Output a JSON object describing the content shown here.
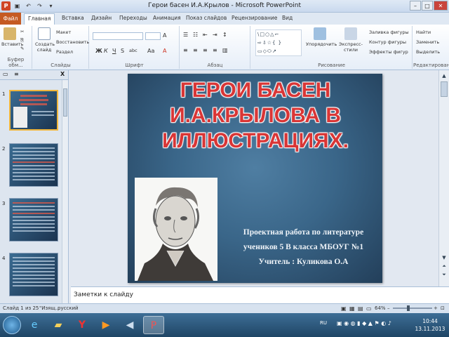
{
  "window": {
    "title": "Герои басен И.А.Крылов - Microsoft PowerPoint",
    "minimize": "–",
    "maximize": "□",
    "close": "✕"
  },
  "tabs": [
    "Файл",
    "Главная",
    "Вставка",
    "Дизайн",
    "Переходы",
    "Анимация",
    "Показ слайдов",
    "Рецензирование",
    "Вид"
  ],
  "ribbon": {
    "clipboard": {
      "paste": "Вставить",
      "group": "Буфер обм..."
    },
    "slides": {
      "create": "Создать слайд",
      "layout": "Макет",
      "reset": "Восстановить",
      "section": "Раздел",
      "group": "Слайды"
    },
    "font": {
      "group": "Шрифт",
      "bold": "Ж",
      "italic": "К",
      "underline": "Ч",
      "strike": "S",
      "shadow": "abc",
      "aa": "Aa",
      "size_up": "A",
      "color": "A"
    },
    "paragraph": {
      "group": "Абзац"
    },
    "drawing": {
      "arrange": "Упорядочить",
      "quick_styles": "Экспресс-стили",
      "fill": "Заливка фигуры",
      "outline": "Контур фигуры",
      "effects": "Эффекты фигур",
      "group": "Рисование"
    },
    "editing": {
      "find": "Найти",
      "replace": "Заменить",
      "select": "Выделить",
      "group": "Редактирование"
    }
  },
  "panel": {
    "tab_slides": "▭",
    "tab_outline": "≡",
    "close": "X"
  },
  "thumbnails": [
    {
      "num": "1"
    },
    {
      "num": "2"
    },
    {
      "num": "3"
    },
    {
      "num": "4"
    }
  ],
  "slide": {
    "title": "ГЕРОИ БАСЕН И.А.КРЫЛОВА В ИЛЛЮСТРАЦИЯХ.",
    "lines": [
      "Проектная работа по литературе",
      "учеников 5 В класса МБОУГ №1",
      "Учитель : Куликова О.А"
    ]
  },
  "notes": {
    "text": "Заметки к слайду"
  },
  "status": {
    "slide": "Слайд 1 из 25",
    "theme": "\"Изящ...",
    "lang": "русский",
    "zoom": "64%"
  },
  "clock": {
    "time": "10:44",
    "date": "13.11.2013"
  },
  "tray": {
    "lang": "RU"
  }
}
